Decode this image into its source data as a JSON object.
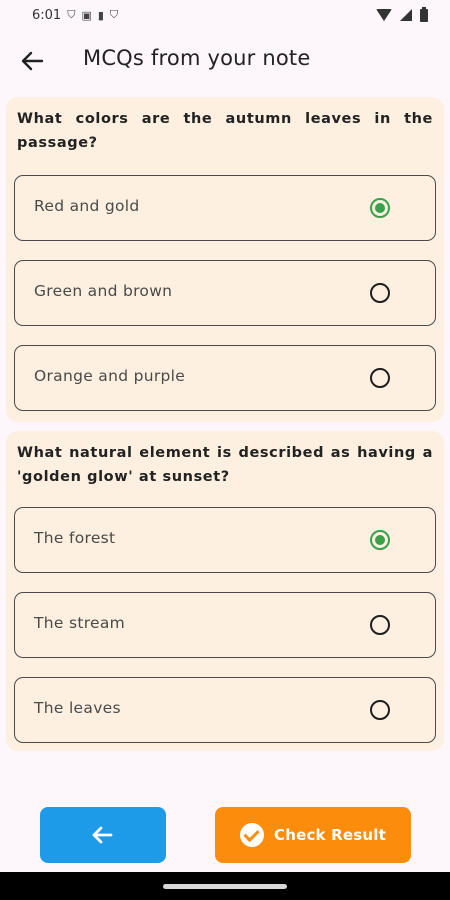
{
  "status_bar": {
    "time": "6:01",
    "icons": [
      "shield-icon",
      "app-icon",
      "sim-icon",
      "shield-icon"
    ],
    "right_icons": [
      "wifi-icon",
      "signal-icon",
      "battery-icon"
    ]
  },
  "app_bar": {
    "back_icon": "arrow-left-icon",
    "title": "MCQs from your note"
  },
  "questions": [
    {
      "text": "What colors are the autumn leaves in the passage?",
      "options": [
        {
          "label": "Red and gold",
          "selected": true
        },
        {
          "label": "Green and brown",
          "selected": false
        },
        {
          "label": "Orange and purple",
          "selected": false
        }
      ]
    },
    {
      "text": "What natural element is described as having a 'golden glow' at sunset?",
      "options": [
        {
          "label": "The forest",
          "selected": true
        },
        {
          "label": "The stream",
          "selected": false
        },
        {
          "label": "The leaves",
          "selected": false
        }
      ]
    }
  ],
  "footer": {
    "back_icon": "arrow-left-icon",
    "check_icon": "check-circle-icon",
    "check_label": "Check Result"
  },
  "colors": {
    "background": "#fdf6fb",
    "card": "#fdf0e0",
    "selected_radio": "#3aa04a",
    "back_button": "#1e9be8",
    "check_button": "#fb8c0c"
  }
}
